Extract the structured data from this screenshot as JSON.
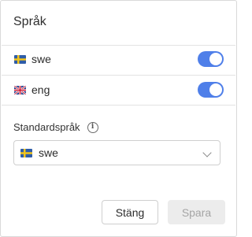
{
  "dialog": {
    "title": "Språk",
    "languages": [
      {
        "code": "swe",
        "flag": "sweden-flag-icon",
        "enabled": true
      },
      {
        "code": "eng",
        "flag": "uk-flag-icon",
        "enabled": true
      }
    ],
    "default_language": {
      "label": "Standardspråk",
      "info_icon": "info-icon",
      "selected": "swe",
      "selected_flag": "sweden-flag-icon"
    },
    "buttons": {
      "close_label": "Stäng",
      "save_label": "Spara"
    }
  },
  "colors": {
    "toggle_on": "#4f7fe9",
    "disabled_button_bg": "#ececec",
    "disabled_button_text": "#a5a5a5"
  }
}
